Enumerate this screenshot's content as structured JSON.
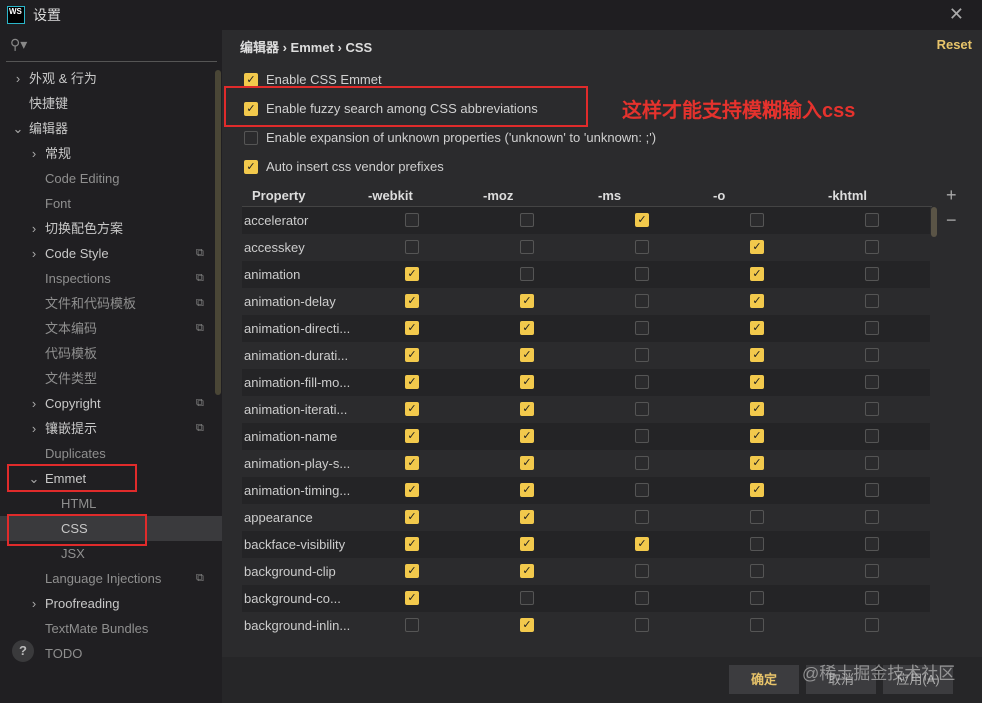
{
  "window": {
    "title": "设置",
    "logo": "WS",
    "close": "✕"
  },
  "search": {
    "icon": "search-icon"
  },
  "sidebar": [
    {
      "label": "外观 & 行为",
      "level": 0,
      "arrow": "›"
    },
    {
      "label": "快捷键",
      "level": 0
    },
    {
      "label": "编辑器",
      "level": 0,
      "arrow": "⌄"
    },
    {
      "label": "常规",
      "level": 1,
      "arrow": "›"
    },
    {
      "label": "Code Editing",
      "level": 1,
      "dim": true
    },
    {
      "label": "Font",
      "level": 1,
      "dim": true
    },
    {
      "label": "切换配色方案",
      "level": 1,
      "arrow": "›"
    },
    {
      "label": "Code Style",
      "level": 1,
      "arrow": "›",
      "copy": true
    },
    {
      "label": "Inspections",
      "level": 1,
      "dim": true,
      "copy": true
    },
    {
      "label": "文件和代码模板",
      "level": 1,
      "dim": true,
      "copy": true
    },
    {
      "label": "文本编码",
      "level": 1,
      "dim": true,
      "copy": true
    },
    {
      "label": "代码模板",
      "level": 1,
      "dim": true
    },
    {
      "label": "文件类型",
      "level": 1,
      "dim": true
    },
    {
      "label": "Copyright",
      "level": 1,
      "arrow": "›",
      "copy": true
    },
    {
      "label": "镶嵌提示",
      "level": 1,
      "arrow": "›",
      "copy": true
    },
    {
      "label": "Duplicates",
      "level": 1,
      "dim": true
    },
    {
      "label": "Emmet",
      "level": 1,
      "arrow": "⌄"
    },
    {
      "label": "HTML",
      "level": 2,
      "dim": true
    },
    {
      "label": "CSS",
      "level": 2,
      "selected": true
    },
    {
      "label": "JSX",
      "level": 2,
      "dim": true
    },
    {
      "label": "Language Injections",
      "level": 1,
      "dim": true,
      "copy": true
    },
    {
      "label": "Proofreading",
      "level": 1,
      "arrow": "›"
    },
    {
      "label": "TextMate Bundles",
      "level": 1,
      "dim": true
    },
    {
      "label": "TODO",
      "level": 1,
      "dim": true
    }
  ],
  "breadcrumb": "编辑器  ›  Emmet  ›  CSS",
  "reset": "Reset",
  "options": [
    {
      "label": "Enable CSS Emmet",
      "checked": true
    },
    {
      "label": "Enable fuzzy search among CSS abbreviations",
      "checked": true
    },
    {
      "label": "Enable expansion of unknown properties ('unknown' to 'unknown: ;')",
      "checked": false
    },
    {
      "label": "Auto insert css vendor prefixes",
      "checked": true
    }
  ],
  "annotation": "这样才能支持模糊输入css",
  "table": {
    "columns": [
      "Property",
      "-webkit",
      "-moz",
      "-ms",
      "-o",
      "-khtml"
    ],
    "rows": [
      {
        "name": "accelerator",
        "v": [
          0,
          0,
          1,
          0,
          0
        ]
      },
      {
        "name": "accesskey",
        "v": [
          0,
          0,
          0,
          1,
          0
        ]
      },
      {
        "name": "animation",
        "v": [
          1,
          0,
          0,
          1,
          0
        ]
      },
      {
        "name": "animation-delay",
        "v": [
          1,
          1,
          0,
          1,
          0
        ]
      },
      {
        "name": "animation-directi...",
        "v": [
          1,
          1,
          0,
          1,
          0
        ]
      },
      {
        "name": "animation-durati...",
        "v": [
          1,
          1,
          0,
          1,
          0
        ]
      },
      {
        "name": "animation-fill-mo...",
        "v": [
          1,
          1,
          0,
          1,
          0
        ]
      },
      {
        "name": "animation-iterati...",
        "v": [
          1,
          1,
          0,
          1,
          0
        ]
      },
      {
        "name": "animation-name",
        "v": [
          1,
          1,
          0,
          1,
          0
        ]
      },
      {
        "name": "animation-play-s...",
        "v": [
          1,
          1,
          0,
          1,
          0
        ]
      },
      {
        "name": "animation-timing...",
        "v": [
          1,
          1,
          0,
          1,
          0
        ]
      },
      {
        "name": "appearance",
        "v": [
          1,
          1,
          0,
          0,
          0
        ]
      },
      {
        "name": "backface-visibility",
        "v": [
          1,
          1,
          1,
          0,
          0
        ]
      },
      {
        "name": "background-clip",
        "v": [
          1,
          1,
          0,
          0,
          0
        ]
      },
      {
        "name": "background-co...",
        "v": [
          1,
          0,
          0,
          0,
          0
        ]
      },
      {
        "name": "background-inlin...",
        "v": [
          0,
          1,
          0,
          0,
          0
        ]
      }
    ],
    "add": "+",
    "remove": "−"
  },
  "footer": {
    "ok": "确定",
    "cancel": "取消",
    "apply": "应用(A)",
    "help": "?"
  },
  "watermark": "@稀土掘金技术社区",
  "colors": {
    "accent": "#f2c94c",
    "highlight": "#e02b2b"
  }
}
